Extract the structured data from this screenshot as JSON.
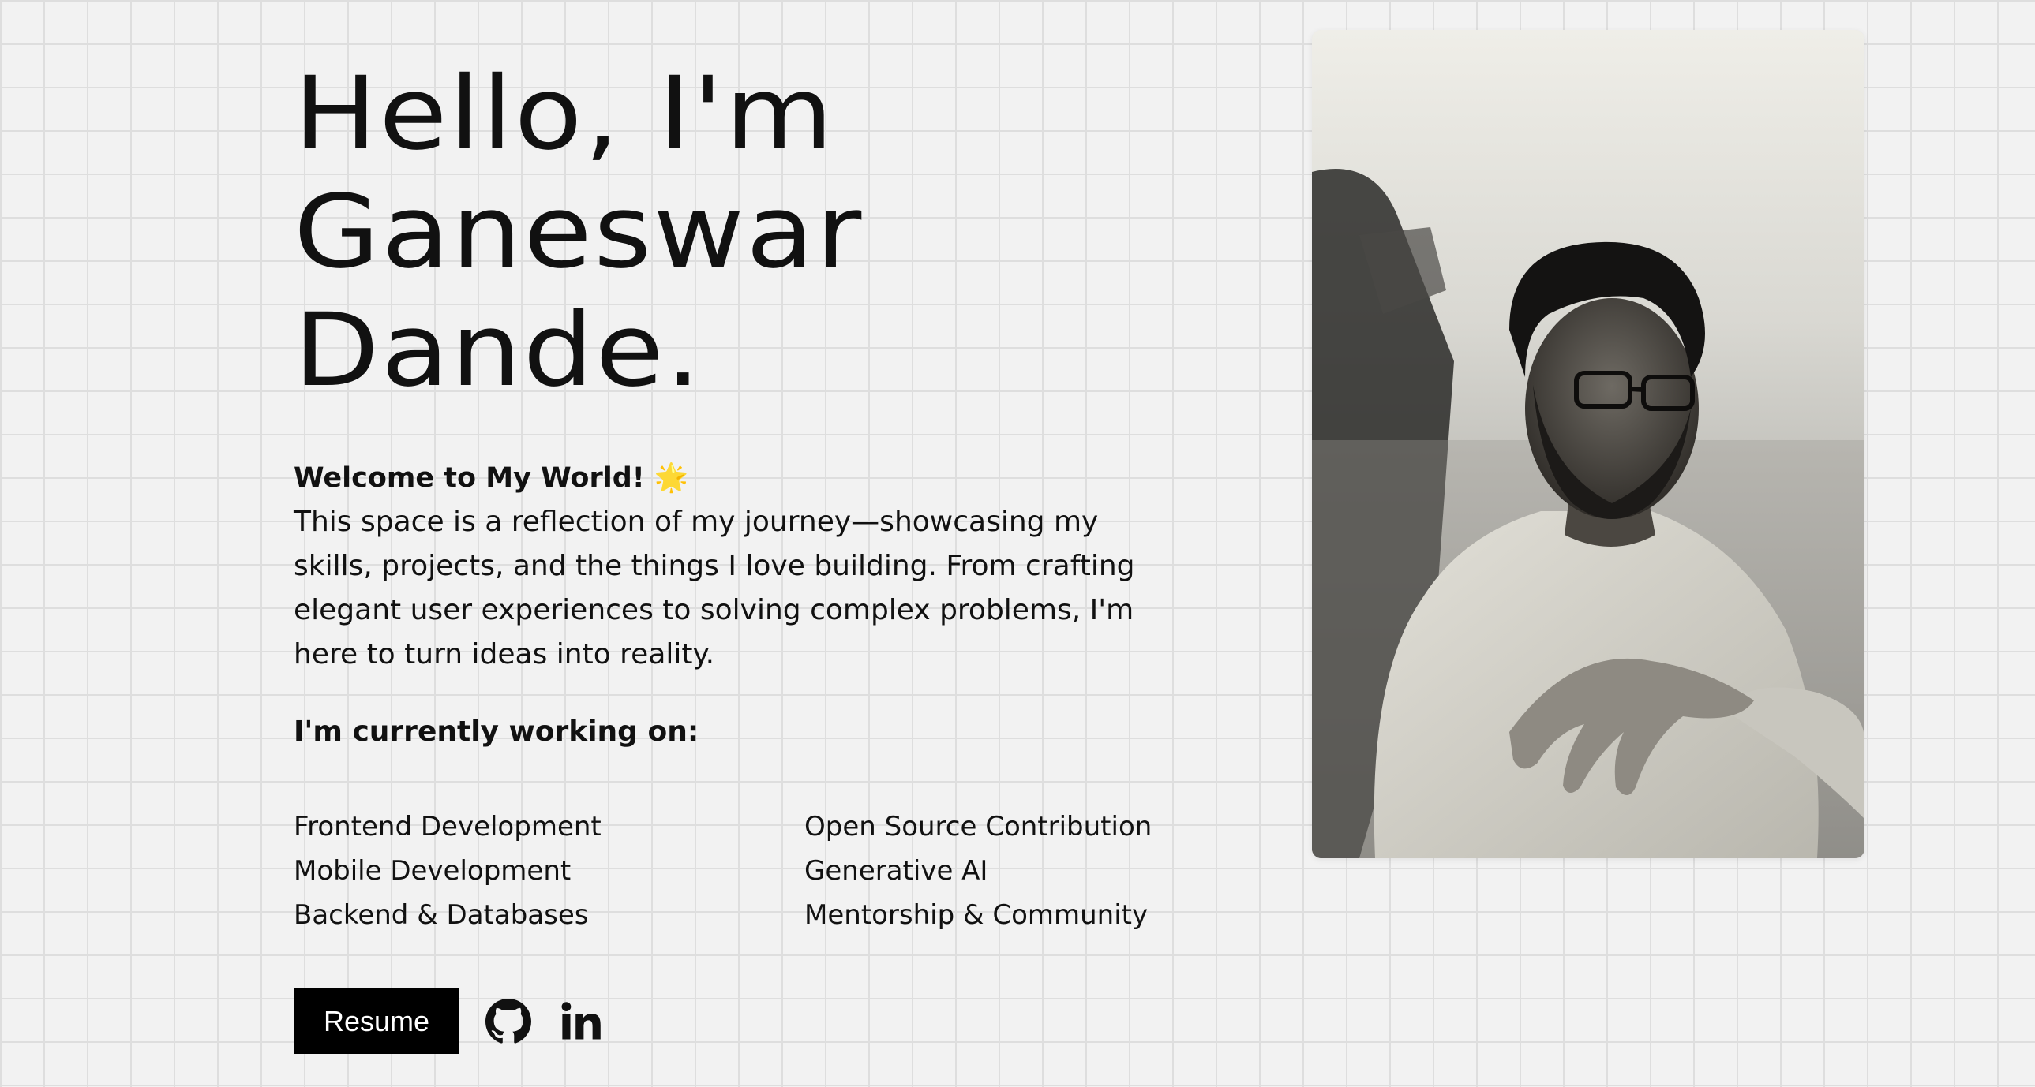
{
  "hero": {
    "line1": "Hello, I'm",
    "line2": "Ganeswar",
    "line3": "Dande."
  },
  "welcome": "Welcome to My World! 🌟",
  "intro": "This space is a reflection of my journey—showcasing my skills, projects, and the things I love building. From crafting elegant user experiences to solving complex problems, I'm here to turn ideas into reality.",
  "working_heading": "I'm currently working on:",
  "focus_left": [
    "Frontend Development",
    "Mobile Development",
    "Backend & Databases"
  ],
  "focus_right": [
    "Open Source Contribution",
    "Generative AI",
    "Mentorship & Community"
  ],
  "actions": {
    "resume_label": "Resume",
    "github_icon": "github-icon",
    "linkedin_icon": "linkedin-icon"
  },
  "colors": {
    "background": "#f2f2f2",
    "grid": "#dedede",
    "text": "#111111",
    "button": "#000000"
  }
}
